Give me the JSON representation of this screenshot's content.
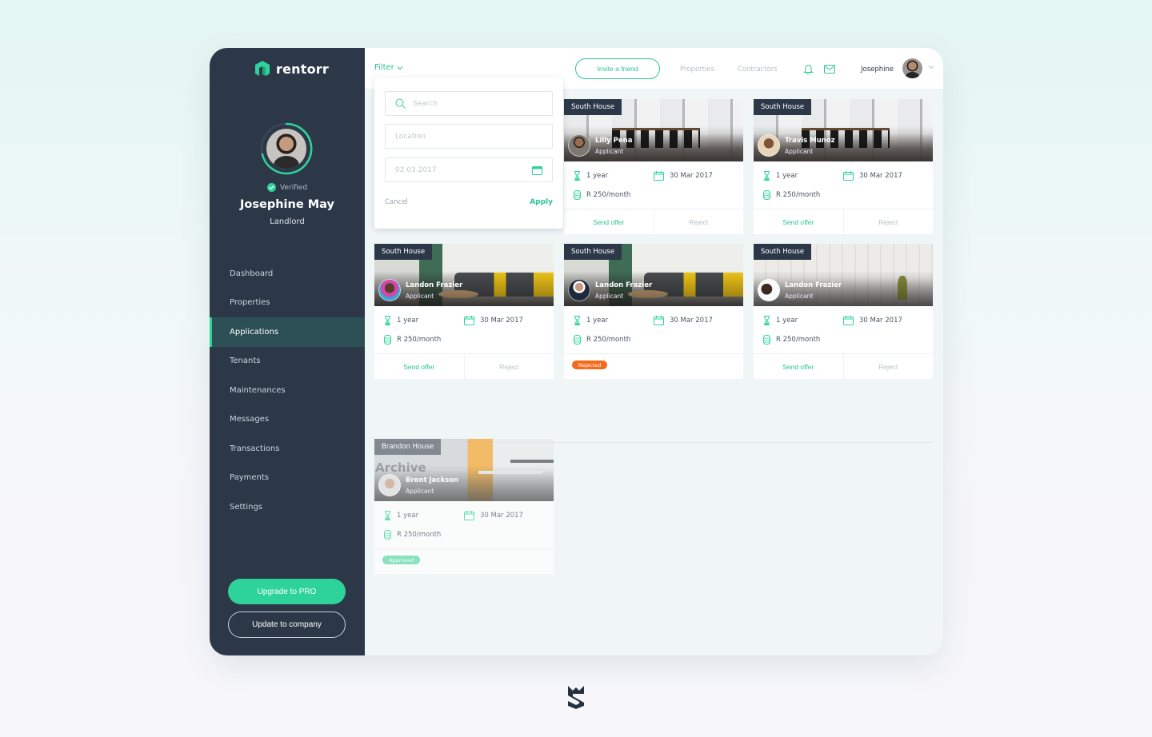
{
  "app": {
    "brand": "rentorr",
    "accent": "#2ed39a",
    "sidebar_bg": "#2c3848"
  },
  "profile": {
    "verified_label": "Verified",
    "name": "Josephine May",
    "role": "Landlord"
  },
  "sidebar": {
    "items": [
      {
        "label": "Dashboard",
        "active": false
      },
      {
        "label": "Properties",
        "active": false
      },
      {
        "label": "Applications",
        "active": true
      },
      {
        "label": "Tenants",
        "active": false
      },
      {
        "label": "Maintenances",
        "active": false
      },
      {
        "label": "Messages",
        "active": false
      },
      {
        "label": "Transactions",
        "active": false
      },
      {
        "label": "Payments",
        "active": false
      },
      {
        "label": "Settings",
        "active": false
      }
    ],
    "upgrade_label": "Upgrade to PRO",
    "company_label": "Update to company"
  },
  "topbar": {
    "filter_label": "Filter",
    "invite_label": "Invite a friend",
    "links": [
      "Properties",
      "Contractors"
    ],
    "user_name": "Josephine"
  },
  "filter_panel": {
    "search_placeholder": "Search",
    "location_placeholder": "Location",
    "date_value": "02.03.2017",
    "cancel_label": "Cancel",
    "apply_label": "Apply"
  },
  "applications": [
    {
      "property": "South House",
      "applicant": "Lilly Pena",
      "role": "Applicant",
      "duration": "1 year",
      "date": "30 Mar 2017",
      "price": "R 250/month",
      "status": "pending"
    },
    {
      "property": "South House",
      "applicant": "Travis Munoz",
      "role": "Applicant",
      "duration": "1 year",
      "date": "30 Mar 2017",
      "price": "R 250/month",
      "status": "pending"
    },
    {
      "property": "South House",
      "applicant": "Landon Frazier",
      "role": "Applicant",
      "duration": "1 year",
      "date": "30 Mar 2017",
      "price": "R 250/month",
      "status": "pending"
    },
    {
      "property": "South House",
      "applicant": "Landon Frazier",
      "role": "Applicant",
      "duration": "1 year",
      "date": "30 Mar 2017",
      "price": "R 250/month",
      "status": "Rejected"
    },
    {
      "property": "South House",
      "applicant": "Landon Frazier",
      "role": "Applicant",
      "duration": "1 year",
      "date": "30 Mar 2017",
      "price": "R 250/month",
      "status": "pending"
    }
  ],
  "card_actions": {
    "send_label": "Send offer",
    "reject_label": "Reject"
  },
  "archive": {
    "title": "Archive",
    "items": [
      {
        "property": "Brandon House",
        "applicant": "Brent Jackson",
        "role": "Applicant",
        "duration": "1 year",
        "date": "30 Mar 2017",
        "price": "R 250/month",
        "status": "Approved"
      }
    ]
  }
}
